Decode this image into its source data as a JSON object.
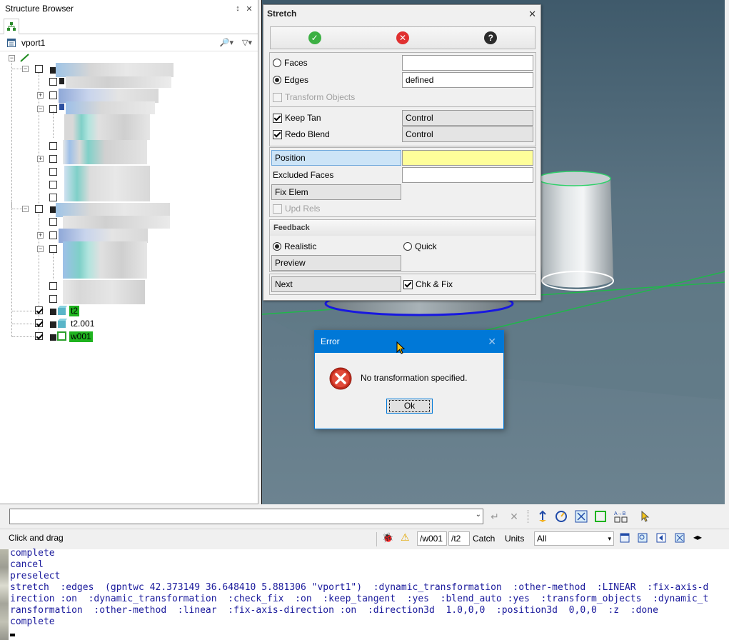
{
  "browser": {
    "title": "Structure Browser",
    "pin_icon": "pin-icon",
    "close_icon": "close-icon",
    "tab_icon": "tree-hierarchy-icon",
    "viewport_label": "vport1",
    "nodes": [
      {
        "label": "t2",
        "highlight": true
      },
      {
        "label": "t2.001",
        "highlight": false
      },
      {
        "label": "w001",
        "highlight": true
      }
    ]
  },
  "stretch": {
    "title": "Stretch",
    "ok_icon": "check-circle-icon",
    "cancel_icon": "cancel-circle-icon",
    "help_icon": "help-circle-icon",
    "help_glyph": "?",
    "faces_label": "Faces",
    "edges_label": "Edges",
    "edges_value": "defined",
    "transform_objects_label": "Transform Objects",
    "keep_tan_label": "Keep Tan",
    "keep_tan_value": "Control",
    "redo_blend_label": "Redo Blend",
    "redo_blend_value": "Control",
    "position_label": "Position",
    "excluded_faces_label": "Excluded Faces",
    "fix_elem_label": "Fix Elem",
    "upd_rels_label": "Upd Rels",
    "feedback_header": "Feedback",
    "realistic_label": "Realistic",
    "quick_label": "Quick",
    "preview_label": "Preview",
    "next_label": "Next",
    "chk_fix_label": "Chk & Fix"
  },
  "error_dialog": {
    "title": "Error",
    "message": "No transformation specified.",
    "ok_label": "Ok",
    "icon": "error-x-icon"
  },
  "status": {
    "hint": "Click and drag",
    "path1": "/w001",
    "path2": "/t2",
    "catch_label": "Catch",
    "units_label": "Units",
    "filter_value": "All"
  },
  "console": {
    "lines": [
      "complete",
      "cancel",
      "preselect",
      "stretch  :edges  (gpntwc 42.373149 36.648410 5.881306 \"vport1\")  :dynamic_transformation  :other-method  :LINEAR  :fix-axis-d",
      "irection :on  :dynamic_transformation  :check_fix  :on  :keep_tangent  :yes  :blend_auto :yes  :transform_objects  :dynamic_t",
      "ransformation  :other-method  :linear  :fix-axis-direction :on  :direction3d  1.0,0,0  :position3d  0,0,0  :z  :done",
      "complete"
    ]
  },
  "colors": {
    "accent_blue": "#0078d7",
    "highlight_green": "#1fb31f",
    "position_field_yellow": "#fefe9a",
    "console_text": "#1a1a9c"
  }
}
